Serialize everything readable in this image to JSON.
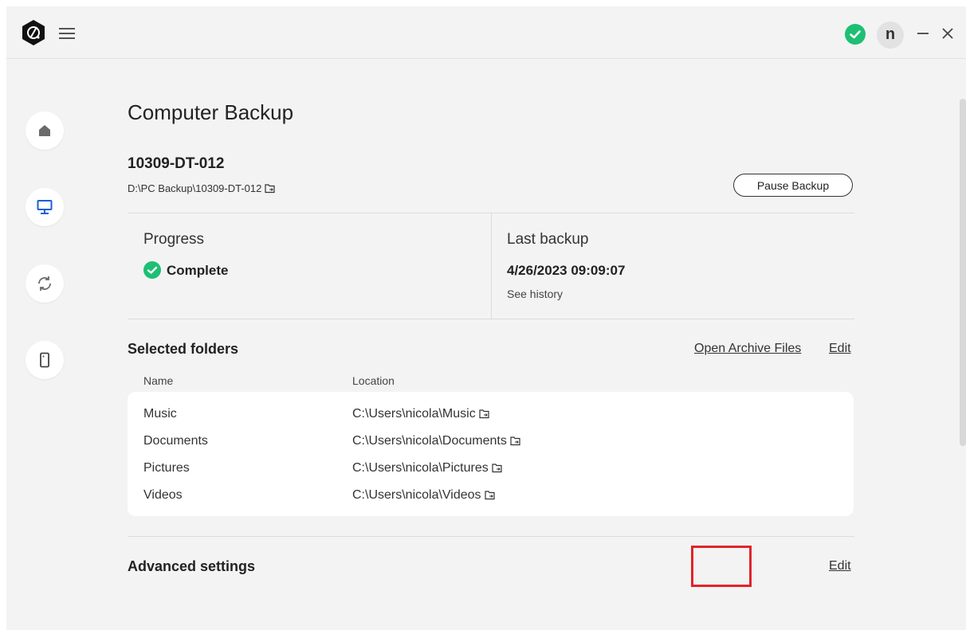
{
  "titlebar": {
    "avatar_initial": "n",
    "status_color": "#1dbf73"
  },
  "nav": {
    "items": [
      {
        "icon": "home-icon"
      },
      {
        "icon": "computer-icon",
        "active": true
      },
      {
        "icon": "sync-icon"
      },
      {
        "icon": "phone-icon"
      }
    ]
  },
  "main": {
    "title": "Computer Backup",
    "device_name": "10309-DT-012",
    "device_path": "D:\\PC Backup\\10309-DT-012",
    "pause_label": "Pause Backup",
    "progress_label": "Progress",
    "progress_value": "Complete",
    "last_backup_label": "Last backup",
    "last_backup_value": "4/26/2023 09:09:07",
    "see_history": "See history",
    "selected_folders_title": "Selected folders",
    "open_archive_label": "Open Archive Files",
    "folders_edit_label": "Edit",
    "col_name": "Name",
    "col_location": "Location",
    "folders": [
      {
        "name": "Music",
        "location": "C:\\Users\\nicola\\Music"
      },
      {
        "name": "Documents",
        "location": "C:\\Users\\nicola\\Documents"
      },
      {
        "name": "Pictures",
        "location": "C:\\Users\\nicola\\Pictures"
      },
      {
        "name": "Videos",
        "location": "C:\\Users\\nicola\\Videos"
      }
    ],
    "advanced_title": "Advanced settings",
    "advanced_edit_label": "Edit"
  },
  "colors": {
    "accent_blue": "#1a5fd8",
    "success_green": "#1dbf73",
    "highlight_red": "#e0242b"
  }
}
